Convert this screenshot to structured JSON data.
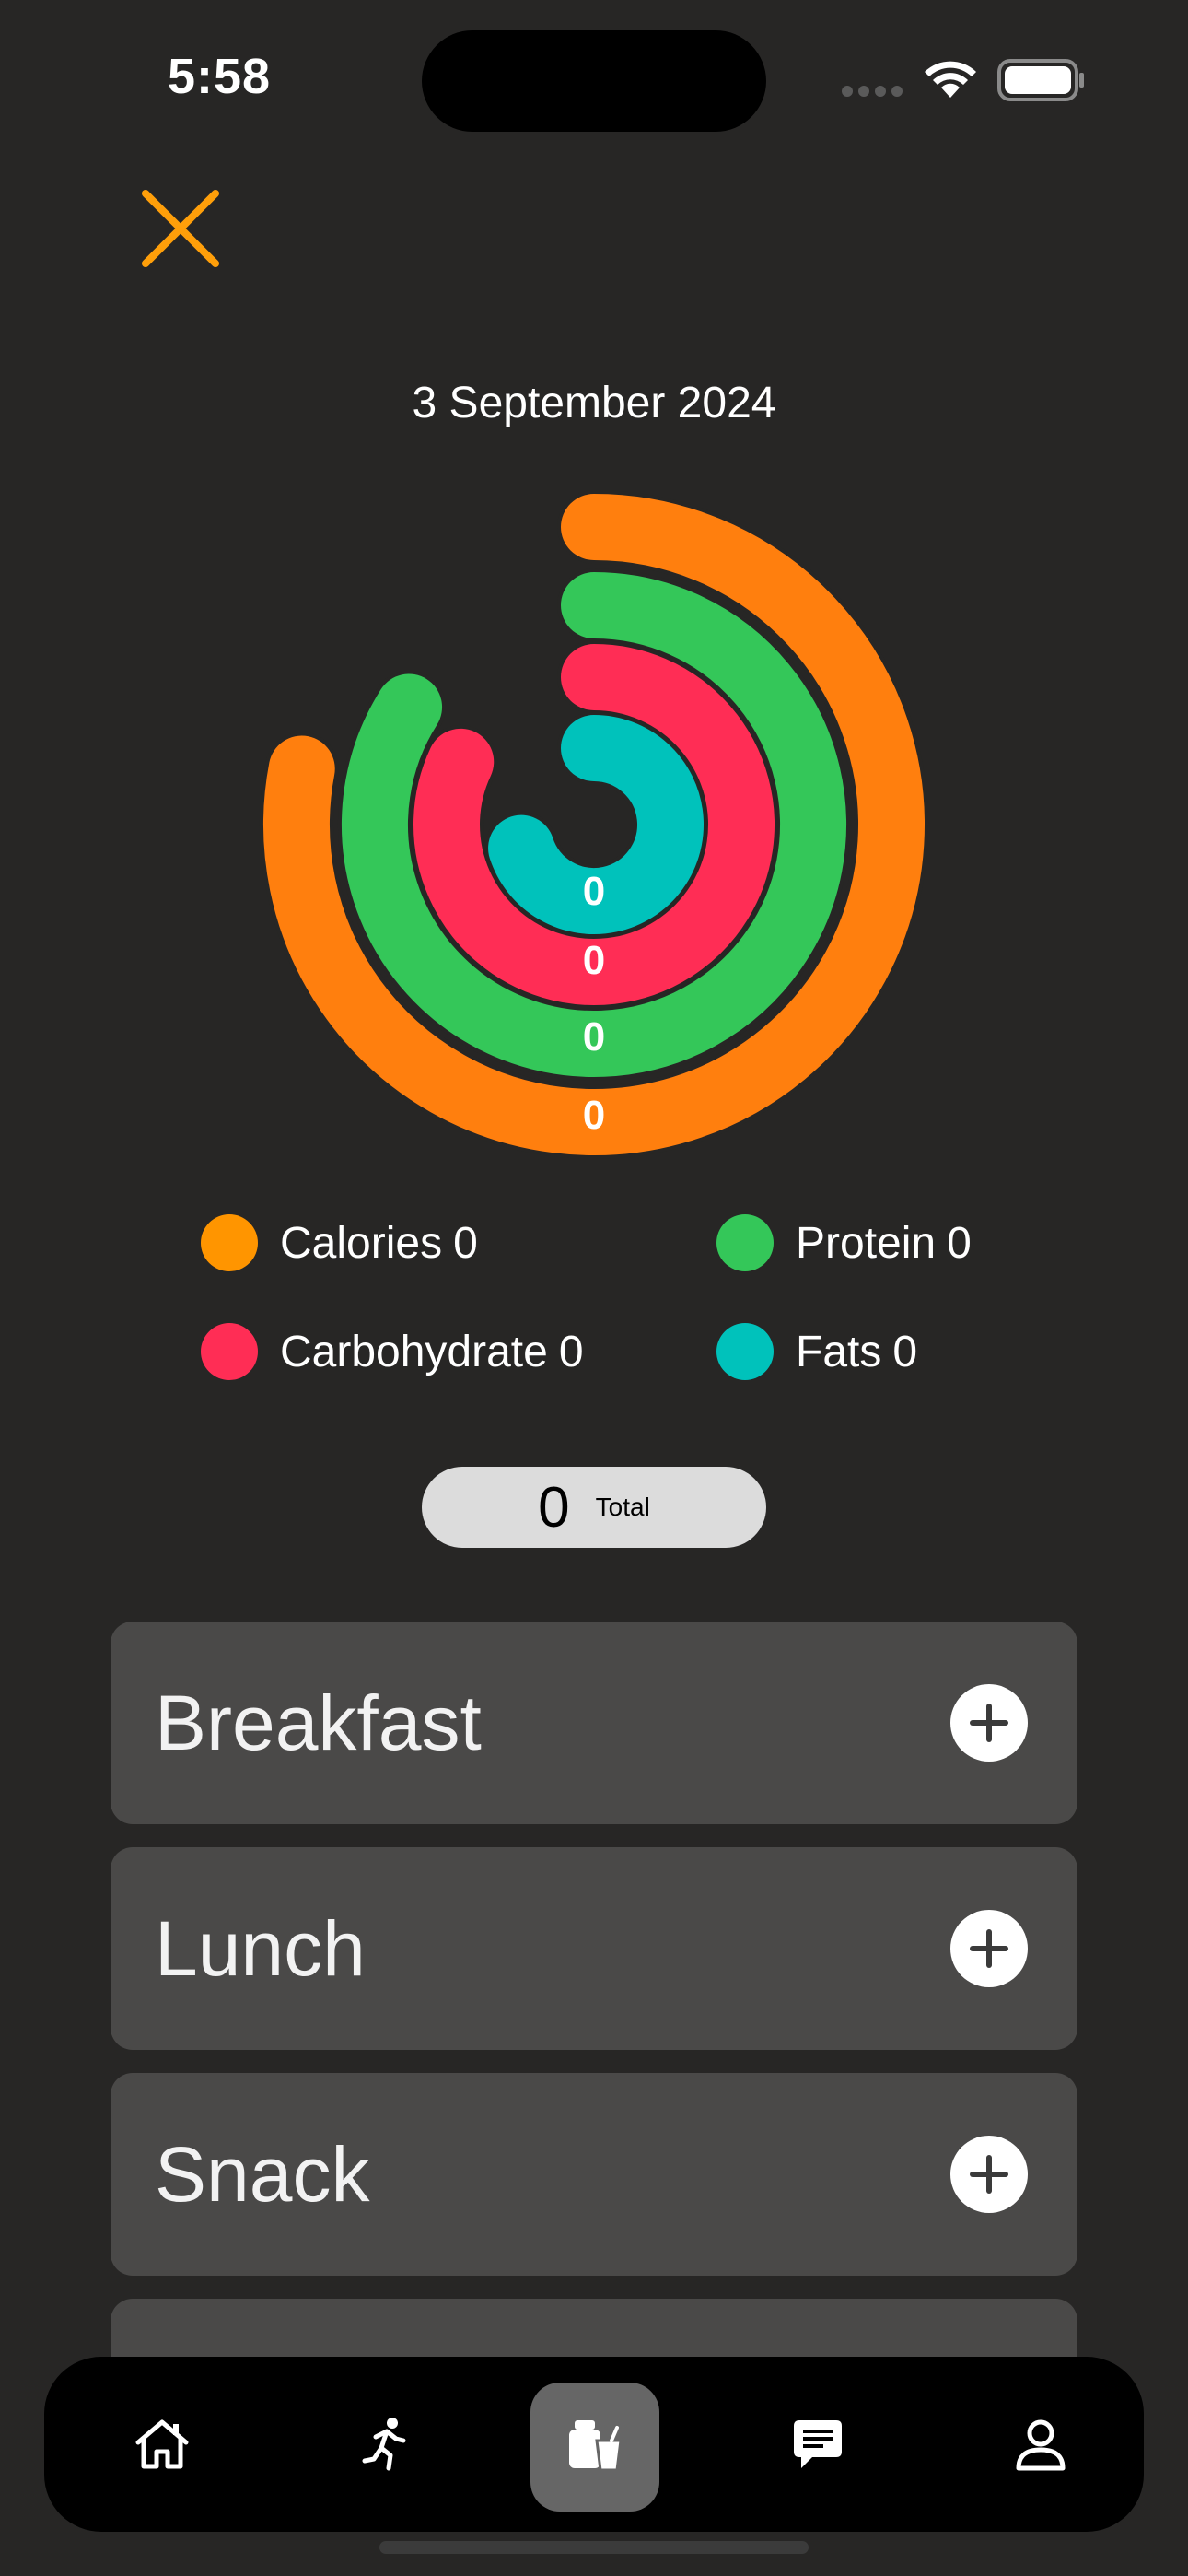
{
  "status_bar": {
    "time": "5:58"
  },
  "date": "3 September 2024",
  "accent_color": "#FF9F0A",
  "rings": [
    {
      "name": "Calories",
      "value": "0",
      "color": "#FF7F0E",
      "progress": 0.78
    },
    {
      "name": "Protein",
      "value": "0",
      "color": "#34C759",
      "progress": 0.84
    },
    {
      "name": "Carbohydrate",
      "value": "0",
      "color": "#FF2D55",
      "progress": 0.82
    },
    {
      "name": "Fats",
      "value": "0",
      "color": "#00C2BB",
      "progress": 0.7
    }
  ],
  "legend": [
    {
      "label": "Calories",
      "value": "0",
      "color": "#FF9500"
    },
    {
      "label": "Protein",
      "value": "0",
      "color": "#34C759"
    },
    {
      "label": "Carbohydrate",
      "value": "0",
      "color": "#FF2D55"
    },
    {
      "label": "Fats",
      "value": "0",
      "color": "#00C2BB"
    }
  ],
  "total": {
    "value": "0",
    "label": "Total"
  },
  "meals": [
    {
      "title": "Breakfast"
    },
    {
      "title": "Lunch"
    },
    {
      "title": "Snack"
    },
    {
      "title": ""
    }
  ],
  "tab_bar": {
    "tabs": [
      {
        "icon": "home-icon"
      },
      {
        "icon": "running-icon"
      },
      {
        "icon": "food-drink-icon",
        "active": true
      },
      {
        "icon": "chat-icon"
      },
      {
        "icon": "profile-icon"
      }
    ]
  }
}
